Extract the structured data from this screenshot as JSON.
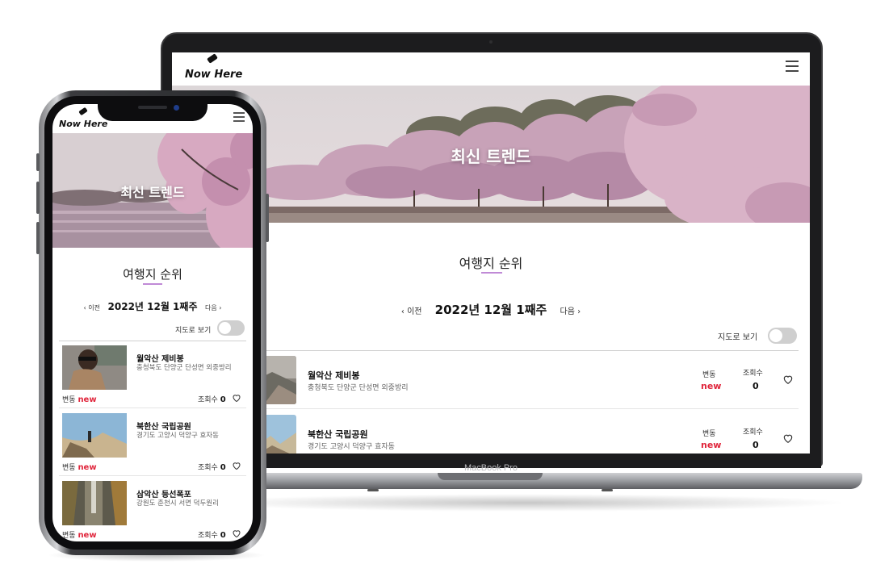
{
  "site": {
    "logo": "Now Here",
    "hero_title": "최신 트렌드",
    "ranking_title": "여행지 순위",
    "prev_label": "이전",
    "next_label": "다음",
    "week_label": "2022년 12월 1째주",
    "map_toggle_label": "지도로 보기",
    "change_label": "변동",
    "views_label": "조회수",
    "accent_color": "#c08ad6",
    "new_color": "#e0263c"
  },
  "device": {
    "laptop_brand": "MacBook Pro"
  },
  "laptop_items": [
    {
      "name": "월악산 제비봉",
      "address": "충청북도 단양군 단성면 외중방리",
      "change": "new",
      "views": "0"
    },
    {
      "name": "북한산 국립공원",
      "address": "경기도 고양시 덕양구 효자동",
      "change": "new",
      "views": "0"
    }
  ],
  "phone_items": [
    {
      "name": "월악산 제비봉",
      "address": "충청북도 단양군 단성면 외중방리",
      "change": "new",
      "views": "0"
    },
    {
      "name": "북한산 국립공원",
      "address": "경기도 고양시 덕양구 효자동",
      "change": "new",
      "views": "0"
    },
    {
      "name": "삼악산 등선폭포",
      "address": "강원도 춘천시 서면 덕두원리",
      "change": "new",
      "views": "0"
    }
  ]
}
